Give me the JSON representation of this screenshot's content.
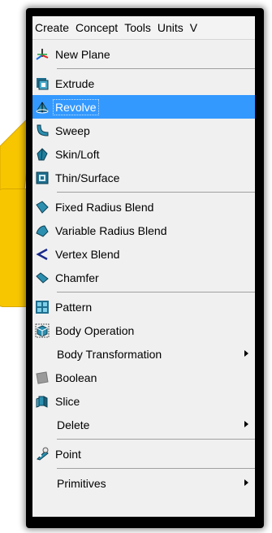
{
  "menubar": {
    "items": [
      "Create",
      "Concept",
      "Tools",
      "Units",
      "V"
    ]
  },
  "menu": {
    "items": [
      {
        "label": "New Plane",
        "icon": "new-plane-icon"
      },
      {
        "label": "Extrude",
        "icon": "extrude-icon"
      },
      {
        "label": "Revolve",
        "icon": "revolve-icon",
        "selected": true
      },
      {
        "label": "Sweep",
        "icon": "sweep-icon"
      },
      {
        "label": "Skin/Loft",
        "icon": "skin-loft-icon"
      },
      {
        "label": "Thin/Surface",
        "icon": "thin-surface-icon"
      },
      {
        "label": "Fixed Radius Blend",
        "icon": "fixed-radius-blend-icon"
      },
      {
        "label": "Variable Radius Blend",
        "icon": "variable-radius-blend-icon"
      },
      {
        "label": "Vertex Blend",
        "icon": "vertex-blend-icon"
      },
      {
        "label": "Chamfer",
        "icon": "chamfer-icon"
      },
      {
        "label": "Pattern",
        "icon": "pattern-icon"
      },
      {
        "label": "Body Operation",
        "icon": "body-operation-icon"
      },
      {
        "label": "Body Transformation",
        "submenu": true
      },
      {
        "label": "Boolean",
        "icon": "boolean-icon"
      },
      {
        "label": "Slice",
        "icon": "slice-icon"
      },
      {
        "label": "Delete",
        "submenu": true
      },
      {
        "label": "Point",
        "icon": "point-icon"
      },
      {
        "label": "Primitives",
        "submenu": true
      }
    ]
  },
  "colors": {
    "selection": "#3399ff",
    "callout": "#f7c600",
    "frame": "#000000"
  }
}
